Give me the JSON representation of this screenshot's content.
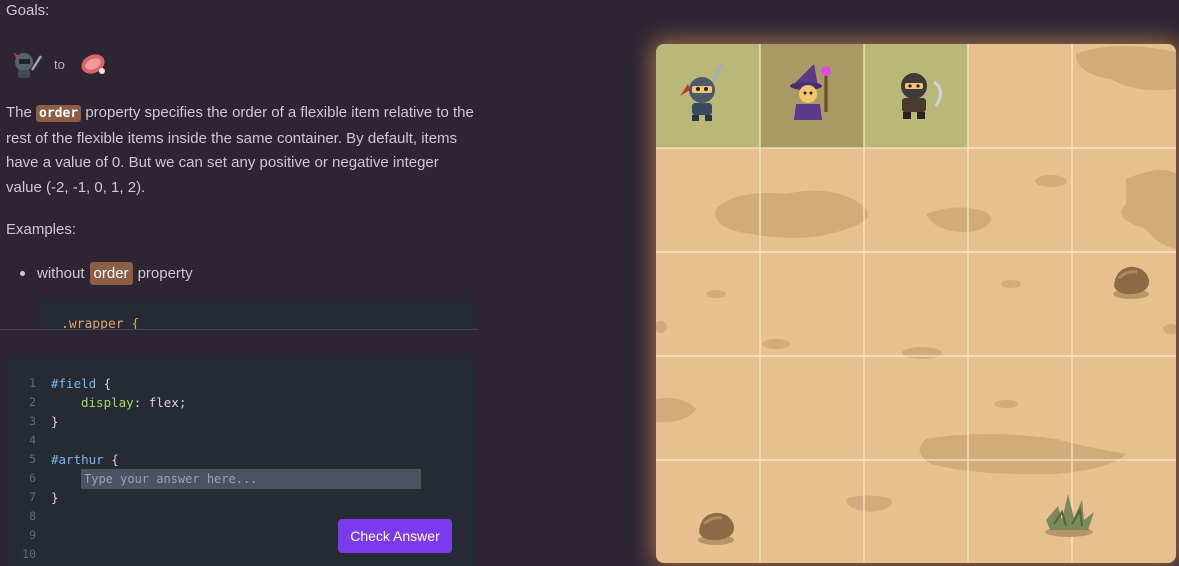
{
  "lesson": {
    "goals_title": "Goals:",
    "goal_connector": "to",
    "desc_before": "The ",
    "desc_keyword": "order",
    "desc_after": " property specifies the order of a flexible item relative to the rest of the flexible items inside the same container. By default, items have a value of 0. But we can set any positive or negative integer value (-2, -1, 0, 1, 2).",
    "examples_title": "Examples:",
    "example_bullet_before": "without",
    "example_bullet_keyword": "order",
    "example_bullet_after": "property",
    "example_code_first_line": ".wrapper {"
  },
  "editor": {
    "line_numbers": [
      "1",
      "2",
      "3",
      "4",
      "5",
      "6",
      "7",
      "8",
      "9",
      "10"
    ],
    "line1_selector": "#field",
    "line1_brace": " {",
    "line2_prop": "display",
    "line2_value": ": flex;",
    "line3": "}",
    "line5_selector": "#arthur",
    "line5_brace": " {",
    "line7": "}",
    "answer_value": "",
    "answer_placeholder": "Type your answer here...",
    "check_button_label": "Check Answer"
  },
  "board": {
    "columns": 5,
    "rows": 5,
    "highlighted_cells": [
      {
        "col": 0,
        "color": "#b9b879"
      },
      {
        "col": 1,
        "color": "#a89a62"
      },
      {
        "col": 2,
        "color": "#b9b879"
      }
    ],
    "characters": [
      "knight",
      "wizard",
      "rogue"
    ],
    "goal_icons": [
      "knight-icon",
      "meat-icon"
    ],
    "obstacles": [
      "rock",
      "rock",
      "shrub"
    ]
  },
  "colors": {
    "accent": "#7c3aed",
    "keyword_bg": "#8b5e45",
    "board_sand": "#e6c18f"
  }
}
